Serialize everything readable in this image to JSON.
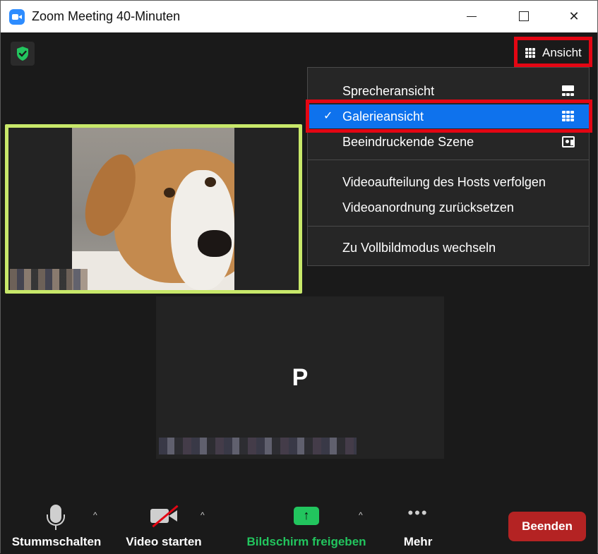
{
  "window": {
    "title": "Zoom Meeting 40-Minuten",
    "minimize_label": "",
    "maximize_label": "",
    "close_label": "✕"
  },
  "header": {
    "view_button_label": "Ansicht"
  },
  "participants": [
    {
      "type": "video",
      "highlighted": true,
      "name_visible": false
    },
    {
      "type": "avatar",
      "initial": "P",
      "name_visible": false
    }
  ],
  "view_menu": {
    "items": [
      {
        "label": "Sprecheransicht",
        "icon": "speaker-view-icon",
        "checked": false
      },
      {
        "label": "Galerieansicht",
        "icon": "gallery-view-icon",
        "checked": true,
        "check_mark": "✓"
      },
      {
        "label": "Beeindruckende Szene",
        "icon": "immersive-scene-icon",
        "checked": false
      },
      {
        "label": "Videoaufteilung des Hosts verfolgen"
      },
      {
        "label": "Videoanordnung zurücksetzen"
      },
      {
        "label": "Zu Vollbildmodus wechseln"
      }
    ]
  },
  "toolbar": {
    "mute_label": "Stummschalten",
    "video_label": "Video starten",
    "share_label": "Bildschirm freigeben",
    "share_arrow": "↑",
    "more_label": "Mehr",
    "more_dots": "•••",
    "caret": "^",
    "end_label": "Beenden"
  },
  "colors": {
    "accent": "#0e72ed",
    "annotation_red": "#e30613",
    "share_green": "#22c55e",
    "end_red": "#b42323",
    "active_speaker_border": "#c8e86a"
  }
}
